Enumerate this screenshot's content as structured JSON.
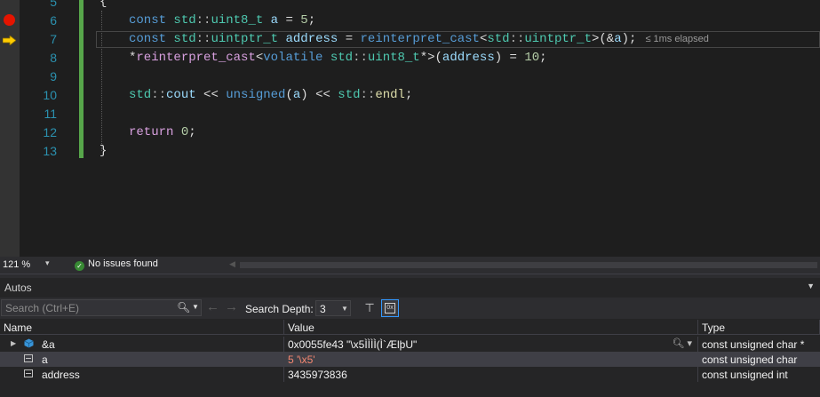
{
  "editor": {
    "lines": [
      {
        "num": "5"
      },
      {
        "num": "6"
      },
      {
        "num": "7"
      },
      {
        "num": "8"
      },
      {
        "num": "9"
      },
      {
        "num": "10"
      },
      {
        "num": "11"
      },
      {
        "num": "12"
      },
      {
        "num": "13"
      }
    ],
    "code": {
      "l5": "{",
      "l6_kw": "const",
      "l6_ns": "std",
      "l6_sep": "::",
      "l6_ty": "uint8_t",
      "l6_var": "a",
      "l6_rest": " = ",
      "l6_num": "5",
      "l6_end": ";",
      "l7_kw": "const",
      "l7_ns": "std",
      "l7_sep": "::",
      "l7_ty": "uintptr_t",
      "l7_var": "address",
      "l7_eq": " = ",
      "l7_fn": "reinterpret_cast",
      "l7_lt": "<",
      "l7_ns2": "std",
      "l7_sep2": "::",
      "l7_ty2": "uintptr_t",
      "l7_gt": ">(&",
      "l7_var2": "a",
      "l7_end": ");",
      "l7_elapsed": "≤ 1ms elapsed",
      "l8_star": "*",
      "l8_fn": "reinterpret_cast",
      "l8_lt": "<",
      "l8_kw": "volatile",
      "l8_ns": "std",
      "l8_sep": "::",
      "l8_ty": "uint8_t",
      "l8_gt": "*>(",
      "l8_var": "address",
      "l8_mid": ") = ",
      "l8_num": "10",
      "l8_end": ";",
      "l10_ns": "std",
      "l10_sep": "::",
      "l10_var": "cout",
      "l10_op": " << ",
      "l10_kw": "unsigned",
      "l10_p1": "(",
      "l10_var2": "a",
      "l10_p2": ")",
      "l10_op2": " << ",
      "l10_ns2": "std",
      "l10_sep2": "::",
      "l10_fn": "endl",
      "l10_end": ";",
      "l12_kw": "return",
      "l12_num": "0",
      "l12_end": ";",
      "l13": "}"
    }
  },
  "status": {
    "zoom": "121 %",
    "issues": "No issues found"
  },
  "autos": {
    "title": "Autos",
    "search_placeholder": "Search (Ctrl+E)",
    "search_depth_label": "Search Depth:",
    "search_depth_value": "3",
    "columns": {
      "name": "Name",
      "value": "Value",
      "type": "Type"
    },
    "rows": [
      {
        "name": "&a",
        "value": "0x0055fe43 \"\\x5ÌÌÌÌ(Ì`ÆlþU\"",
        "type": "const unsigned char *"
      },
      {
        "name": "a",
        "value": "5 '\\x5'",
        "type": "const unsigned char"
      },
      {
        "name": "address",
        "value": "3435973836",
        "type": "const unsigned int"
      }
    ]
  },
  "colors": {
    "breakpoint": "#e51400",
    "current_line_arrow": "#ffcc00",
    "changes_bar": "#57a64a",
    "changed_value": "#f48771"
  }
}
